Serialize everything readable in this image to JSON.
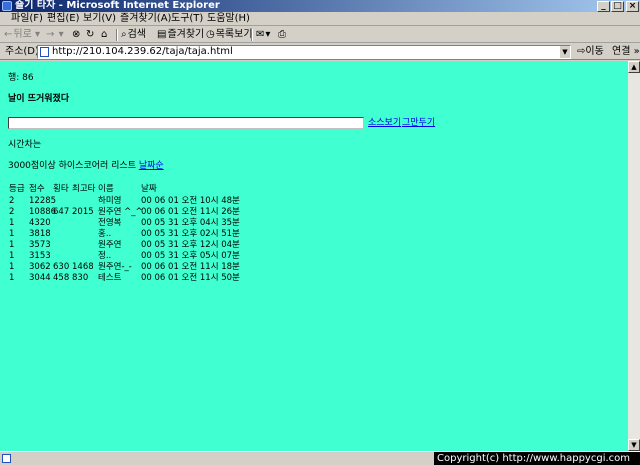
{
  "window": {
    "title": "숄기 타자 - Microsoft Internet Explorer",
    "min": "_",
    "max": "□",
    "close": "×"
  },
  "menu": [
    "파일(F)",
    "편집(E)",
    "보기(V)",
    "즐겨찾기(A)",
    "도구(T)",
    "도움말(H)"
  ],
  "toolbar": {
    "back": "뒤로",
    "search": "검색",
    "favorites": "즐겨찾기",
    "history": "목록보기"
  },
  "address": {
    "label": "주소(D)",
    "url": "http://210.104.239.62/taja/taja.html",
    "go": "이동",
    "links": "연결 »"
  },
  "page": {
    "score_line": "행: 86",
    "sentence": "날이 뜨거워졌다",
    "input_value": "",
    "view_source": "소스보기",
    "stop": "그만두기",
    "time_label": "시간차는",
    "ranking_text": "3000점이상 하이스코어러 리스트",
    "ranking_link": "날짜순"
  },
  "table": {
    "headers": {
      "grade": "등급",
      "score": "점수",
      "miss": "횡타",
      "best": "최고타",
      "name": "이름",
      "date": "날짜"
    },
    "rows": [
      {
        "grade": "2",
        "score": "12285",
        "miss": "",
        "best": "",
        "name": "하미영",
        "date": "00 06 01 오전 10시 48분"
      },
      {
        "grade": "2",
        "score": "10886",
        "miss": "647",
        "best": "2015",
        "name": "원주연 ^_^",
        "date": "00 06 01 오전 11시 26분"
      },
      {
        "grade": "1",
        "score": "4320",
        "miss": "",
        "best": "",
        "name": "전영복",
        "date": "00 05 31 오후 04시 35분"
      },
      {
        "grade": "1",
        "score": "3818",
        "miss": "",
        "best": "",
        "name": "홍..",
        "date": "00 05 31 오후 02시 51분"
      },
      {
        "grade": "1",
        "score": "3573",
        "miss": "",
        "best": "",
        "name": "원주연",
        "date": "00 05 31 오후 12시 04분"
      },
      {
        "grade": "1",
        "score": "3153",
        "miss": "",
        "best": "",
        "name": "정..",
        "date": "00 05 31 오후 05시 07분"
      },
      {
        "grade": "1",
        "score": "3062",
        "miss": "630",
        "best": "1468",
        "name": "원주연-_-",
        "date": "00 06 01 오전 11시 18분"
      },
      {
        "grade": "1",
        "score": "3044",
        "miss": "458",
        "best": "830",
        "name": "테스트",
        "date": "00 06 01 오전 11시 50분"
      }
    ]
  },
  "status": {
    "copyright": "Copyright(c) http://www.happycgi.com"
  },
  "colors": {
    "page_background": "#40ffd0",
    "link": "#0000ee",
    "titlebar_start": "#0a246a",
    "titlebar_end": "#a6caf0"
  },
  "icons": [
    "ie-logo-icon",
    "back-arrow-icon",
    "forward-arrow-icon",
    "stop-icon",
    "refresh-icon",
    "home-icon",
    "search-icon",
    "favorites-icon",
    "history-icon",
    "mail-icon",
    "print-icon",
    "page-icon",
    "dropdown-arrow-icon",
    "go-arrow-icon"
  ]
}
